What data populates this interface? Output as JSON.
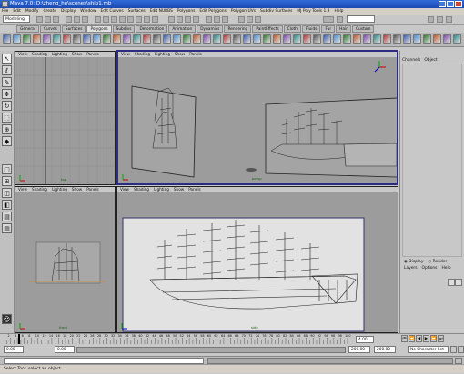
{
  "window": {
    "title": "Maya 7.0: D:\\zheng_he\\scenes\\ship1.mb"
  },
  "menu": [
    "File",
    "Edit",
    "Modify",
    "Create",
    "Display",
    "Window",
    "Edit Curves",
    "Surfaces",
    "Edit NURBS",
    "Polygons",
    "Edit Polygons",
    "Polygon UVs",
    "Subdiv Surfaces",
    "MJ Poly Tools 1.3",
    "Help"
  ],
  "status": {
    "mode": "Modeling"
  },
  "shelf_tabs": [
    "General",
    "Curves",
    "Surfaces",
    "Polygons",
    "Subdivs",
    "Deformation",
    "Animation",
    "Dynamics",
    "Rendering",
    "PaintEffects",
    "Cloth",
    "Fluids",
    "Fur",
    "Hair",
    "Custom"
  ],
  "shelf_active": "Polygons",
  "view_menu": [
    "View",
    "Shading",
    "Lighting",
    "Show",
    "Panels"
  ],
  "views": {
    "top": "top",
    "persp": "persp",
    "front": "front",
    "side": "side"
  },
  "channel_box": {
    "tabs": [
      "Channels",
      "Object"
    ]
  },
  "layer_editor": {
    "display": "Display",
    "render": "Render",
    "menu": [
      "Layers",
      "Options",
      "Help"
    ]
  },
  "timeline": {
    "ticks": [
      "2",
      "4",
      "6",
      "8",
      "10",
      "12",
      "14",
      "16",
      "18",
      "20",
      "22",
      "24",
      "26",
      "28",
      "30",
      "32",
      "34",
      "36",
      "38",
      "40",
      "42",
      "44",
      "46",
      "48",
      "50",
      "52",
      "54",
      "56",
      "58",
      "60",
      "62",
      "64",
      "66",
      "68",
      "70",
      "72",
      "74",
      "76",
      "78",
      "80",
      "82",
      "84",
      "86",
      "88",
      "90",
      "92",
      "94",
      "96",
      "98",
      "100"
    ],
    "current": "4.00"
  },
  "range": {
    "start": "0.00",
    "inner": "0.00",
    "end1": "200.00",
    "end2": "200.00",
    "char_set": "No Character Set"
  },
  "help_line": "Select Tool: select an object"
}
